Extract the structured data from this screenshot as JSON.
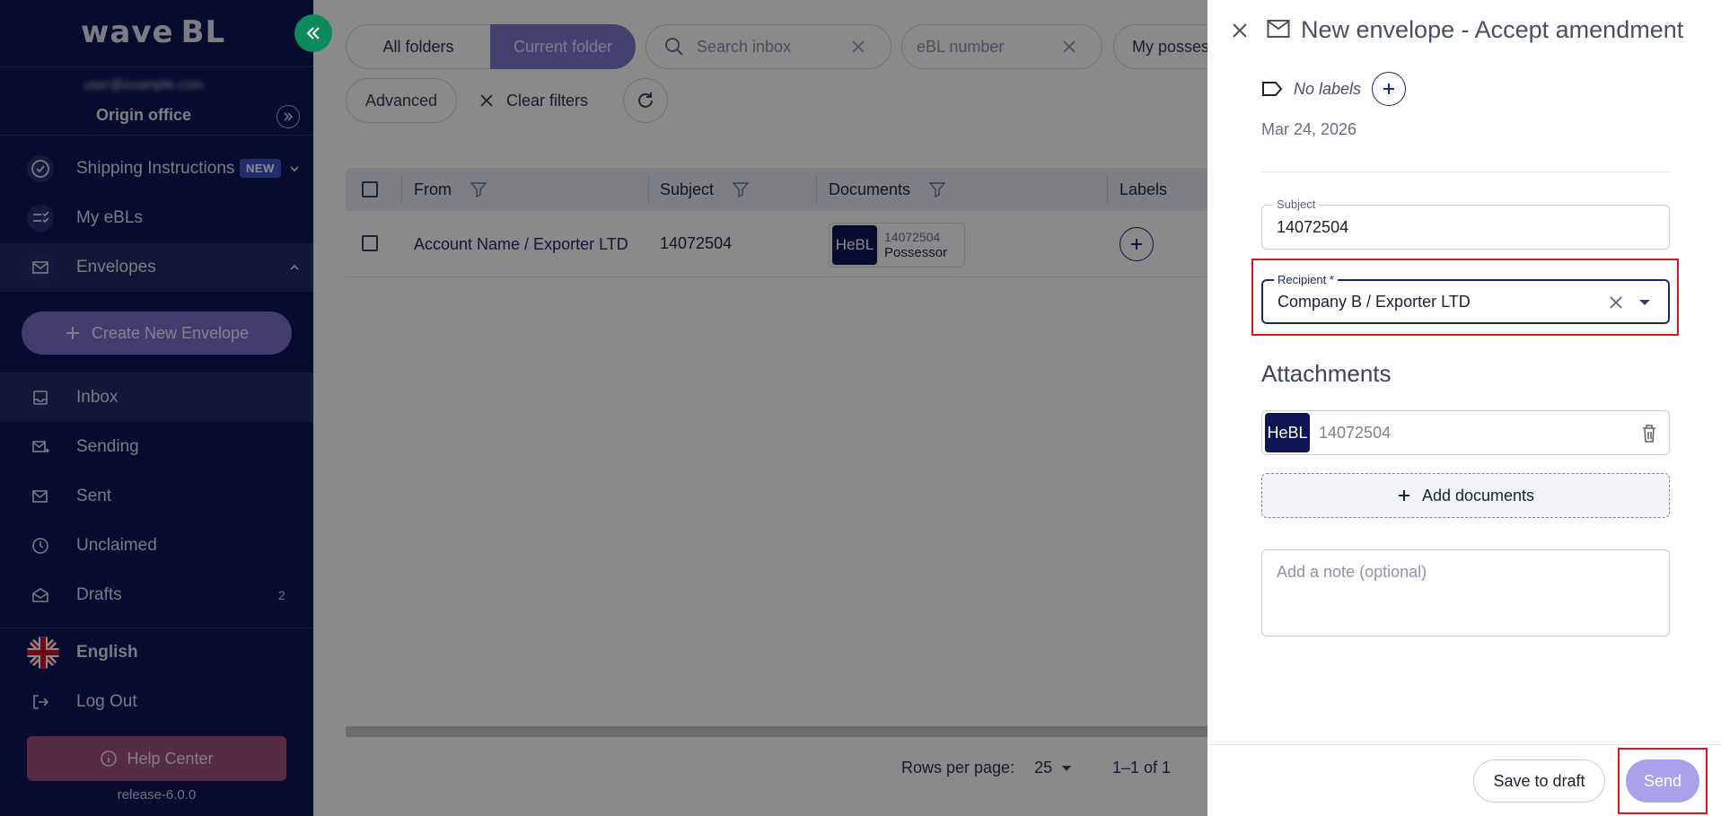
{
  "app": {
    "logo": "wave",
    "logo_suffix": "BL",
    "release": "release-6.0.0"
  },
  "account": {
    "email": "user@example.com",
    "office": "Origin office"
  },
  "sidebar": {
    "items": [
      {
        "label": "Shipping Instructions",
        "badge": "NEW",
        "icon": "check-circle-icon"
      },
      {
        "label": "My eBLs",
        "icon": "checklist-icon"
      },
      {
        "label": "Envelopes",
        "icon": "envelope-icon"
      },
      {
        "label": "Inbox",
        "icon": "inbox-icon"
      },
      {
        "label": "Sending",
        "icon": "sending-icon"
      },
      {
        "label": "Sent",
        "icon": "sent-icon"
      },
      {
        "label": "Unclaimed",
        "icon": "clock-icon"
      },
      {
        "label": "Drafts",
        "count": "2",
        "icon": "drafts-icon"
      }
    ],
    "create_label": "Create New Envelope",
    "language": "English",
    "logout": "Log Out",
    "help": "Help Center"
  },
  "filters": {
    "all_folders": "All folders",
    "current_folder": "Current folder",
    "search_placeholder": "Search inbox",
    "ebl_placeholder": "eBL number",
    "possession": "My possess",
    "advanced": "Advanced",
    "clear": "Clear filters"
  },
  "table": {
    "headers": {
      "from": "From",
      "subject": "Subject",
      "documents": "Documents",
      "labels": "Labels"
    },
    "rows": [
      {
        "from": "Account Name / Exporter LTD",
        "subject": "14072504",
        "doc_type": "HeBL",
        "doc_number": "14072504",
        "doc_role": "Possessor"
      }
    ]
  },
  "pagination": {
    "rows_label": "Rows per page:",
    "rows_value": "25",
    "range": "1–1 of 1"
  },
  "drawer": {
    "title": "New envelope - Accept amendment",
    "no_labels": "No labels",
    "date": "Mar 24, 2026",
    "subject_label": "Subject",
    "subject_value": "14072504",
    "recipient_label": "Recipient *",
    "recipient_value": "Company B / Exporter LTD",
    "attachments_heading": "Attachments",
    "attachment": {
      "type": "HeBL",
      "number": "14072504"
    },
    "add_documents": "Add documents",
    "note_placeholder": "Add a note (optional)",
    "save_draft": "Save to draft",
    "send": "Send"
  },
  "colors": {
    "sidebar": "#0d1553",
    "accent": "#7f77d0",
    "send": "#a8a2ec",
    "highlight": "#e0171e"
  }
}
